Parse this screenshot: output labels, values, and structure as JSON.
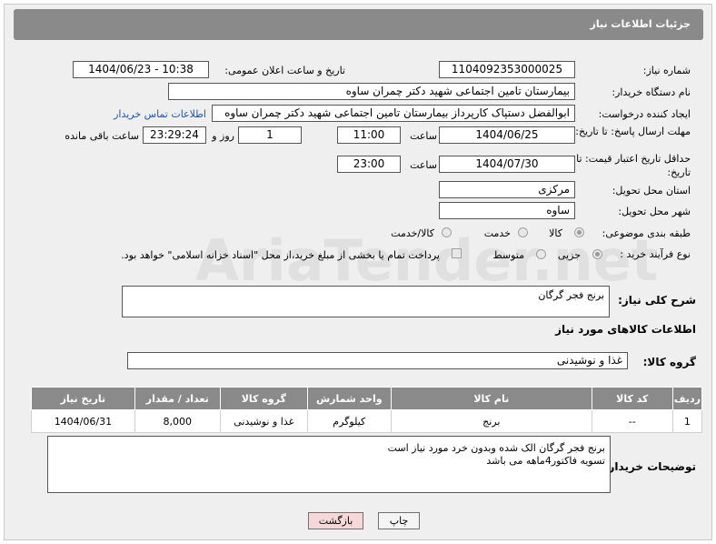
{
  "header": {
    "title": "جزئیات اطلاعات نیاز"
  },
  "fields": {
    "need_number_label": "شماره نیاز:",
    "need_number": "1104092353000025",
    "announce_label": "تاریخ و ساعت اعلان عمومی:",
    "announce_value": "1404/06/23 - 10:38",
    "buyer_label": "نام دستگاه خریدار:",
    "buyer_value": "بیمارستان تامین اجتماعی شهید دکتر چمران ساوه",
    "creator_label": "ایجاد کننده درخواست:",
    "creator_value": "ابوالفضل  دستپاک  کارپرداز بیمارستان تامین اجتماعی شهید دکتر چمران ساوه",
    "contact_link": "اطلاعات تماس خریدار",
    "deadline_label": "مهلت ارسال پاسخ: تا تاریخ:",
    "deadline_date": "1404/06/25",
    "time_label": "ساعت",
    "deadline_time": "11:00",
    "days_value": "1",
    "days_label": "روز و",
    "remaining_time": "23:29:24",
    "remaining_label": "ساعت باقی مانده",
    "price_label": "حداقل تاریخ اعتبار قیمت: تا تاریخ:",
    "price_date": "1404/07/30",
    "price_time": "23:00",
    "province_label": "استان محل تحویل:",
    "province_value": "مرکزی",
    "city_label": "شهر محل تحویل:",
    "city_value": "ساوه",
    "category_label": "طبقه بندی موضوعی:",
    "category_options": [
      "کالا",
      "خدمت",
      "کالا/خدمت"
    ],
    "process_label": "نوع فرآیند خرید :",
    "process_options": [
      "جزیی",
      "متوسط"
    ],
    "payment_note": "پرداخت تمام یا بخشی از مبلغ خرید،از محل \"اسناد خزانه اسلامی\" خواهد بود."
  },
  "summary": {
    "label": "شرح کلی نیاز:",
    "value": "برنج فجر گرگان"
  },
  "goods_section": {
    "title": "اطلاعات کالاهای مورد نیاز",
    "group_label": "گروه کالا:",
    "group_value": "غذا و نوشیدنی"
  },
  "table": {
    "headers": [
      "ردیف",
      "کد کالا",
      "نام کالا",
      "واحد شمارش",
      "گروه کالا",
      "تعداد / مقدار",
      "تاریخ نیاز"
    ],
    "rows": [
      [
        "1",
        "--",
        "برنج",
        "کیلوگرم",
        "غذا و نوشیدنی",
        "8,000",
        "1404/06/31"
      ]
    ]
  },
  "buyer_notes": {
    "label": "توضیحات خریدار:",
    "line1": "برنج فجر گرگان الک شده وبدون خرد مورد نیاز است",
    "line2": "تسویه فاکتور4ماهه می باشد"
  },
  "buttons": {
    "print": "چاپ",
    "back": "بازگشت"
  },
  "watermark": "AriaTender.net"
}
